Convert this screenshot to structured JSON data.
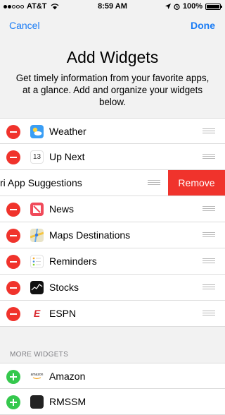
{
  "status_bar": {
    "carrier": "AT&T",
    "time": "8:59 AM",
    "battery": "100%",
    "signal_icon": "signal-dots-icon",
    "wifi_icon": "wifi-icon"
  },
  "nav": {
    "cancel_label": "Cancel",
    "done_label": "Done"
  },
  "header": {
    "title": "Add Widgets",
    "description": "Get timely information from your favorite apps, at a glance. Add and organize your widgets below."
  },
  "widgets": [
    {
      "label": "Weather",
      "icon": "weather-icon"
    },
    {
      "label": "Up Next",
      "icon": "calendar-icon",
      "icon_text": "13"
    },
    {
      "label": "ri App Suggestions",
      "icon": "siri-icon",
      "swiped": true,
      "action_label": "Remove"
    },
    {
      "label": "News",
      "icon": "news-icon"
    },
    {
      "label": "Maps Destinations",
      "icon": "maps-icon"
    },
    {
      "label": "Reminders",
      "icon": "reminders-icon"
    },
    {
      "label": "Stocks",
      "icon": "stocks-icon"
    },
    {
      "label": "ESPN",
      "icon": "espn-icon",
      "icon_text": "E"
    }
  ],
  "more": {
    "header": "MORE WIDGETS",
    "items": [
      {
        "label": "Amazon",
        "icon": "amazon-icon",
        "icon_text": "amazon"
      },
      {
        "label": "RMSSM",
        "icon": "rmssm-icon"
      }
    ]
  },
  "colors": {
    "accent": "#1a7cf5",
    "delete": "#f0332c",
    "add": "#35c84d"
  }
}
